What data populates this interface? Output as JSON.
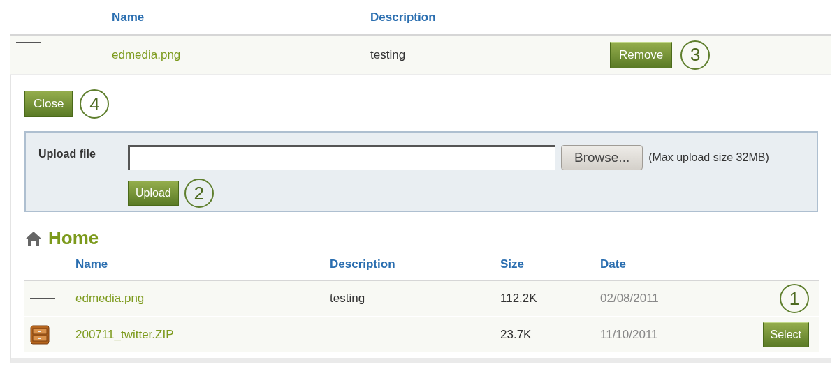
{
  "attached": {
    "columns": [
      "Name",
      "Description"
    ],
    "rows": [
      {
        "kind": "image",
        "name": "edmedia.png",
        "description": "testing",
        "button": "Remove",
        "callout": "3"
      }
    ]
  },
  "close_button": {
    "label": "Close",
    "callout": "4"
  },
  "upload": {
    "label": "Upload file",
    "browse": "Browse...",
    "note": "(Max upload size 32MB)",
    "button": "Upload",
    "callout": "2"
  },
  "folder": {
    "title": "Home"
  },
  "files": {
    "columns": [
      "Name",
      "Description",
      "Size",
      "Date"
    ],
    "rows": [
      {
        "kind": "image",
        "name": "edmedia.png",
        "description": "testing",
        "size": "112.2K",
        "date": "02/08/2011",
        "callout": "1"
      },
      {
        "kind": "archive",
        "name": "200711_twitter.ZIP",
        "size": "23.7K",
        "date": "11/10/2011",
        "button": "Select"
      }
    ]
  }
}
